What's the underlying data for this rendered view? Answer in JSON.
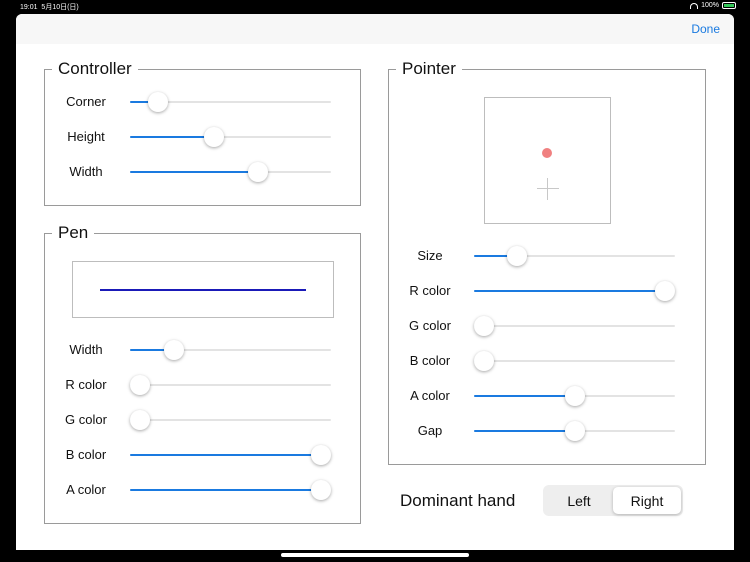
{
  "status": {
    "time": "19:01",
    "date": "5月10日(日)",
    "battery": "100%"
  },
  "navbar": {
    "done_label": "Done"
  },
  "controller": {
    "title": "Controller",
    "sliders": [
      {
        "label": "Corner",
        "value": 0.1
      },
      {
        "label": "Height",
        "value": 0.41
      },
      {
        "label": "Width",
        "value": 0.65
      }
    ]
  },
  "pen": {
    "title": "Pen",
    "line_color": "#1a1ab8",
    "sliders": [
      {
        "label": "Width",
        "value": 0.19
      },
      {
        "label": "R color",
        "value": 0.0
      },
      {
        "label": "G color",
        "value": 0.0
      },
      {
        "label": "B color",
        "value": 1.0
      },
      {
        "label": "A color",
        "value": 1.0
      }
    ]
  },
  "pointer": {
    "title": "Pointer",
    "dot_color": "#f08080",
    "sliders": [
      {
        "label": "Size",
        "value": 0.18
      },
      {
        "label": "R color",
        "value": 1.0
      },
      {
        "label": "G color",
        "value": 0.0
      },
      {
        "label": "B color",
        "value": 0.0
      },
      {
        "label": "A color",
        "value": 0.5
      },
      {
        "label": "Gap",
        "value": 0.5
      }
    ]
  },
  "dominant_hand": {
    "label": "Dominant hand",
    "options": [
      "Left",
      "Right"
    ],
    "selected": "Right"
  },
  "colors": {
    "accent": "#1a7ae0"
  }
}
